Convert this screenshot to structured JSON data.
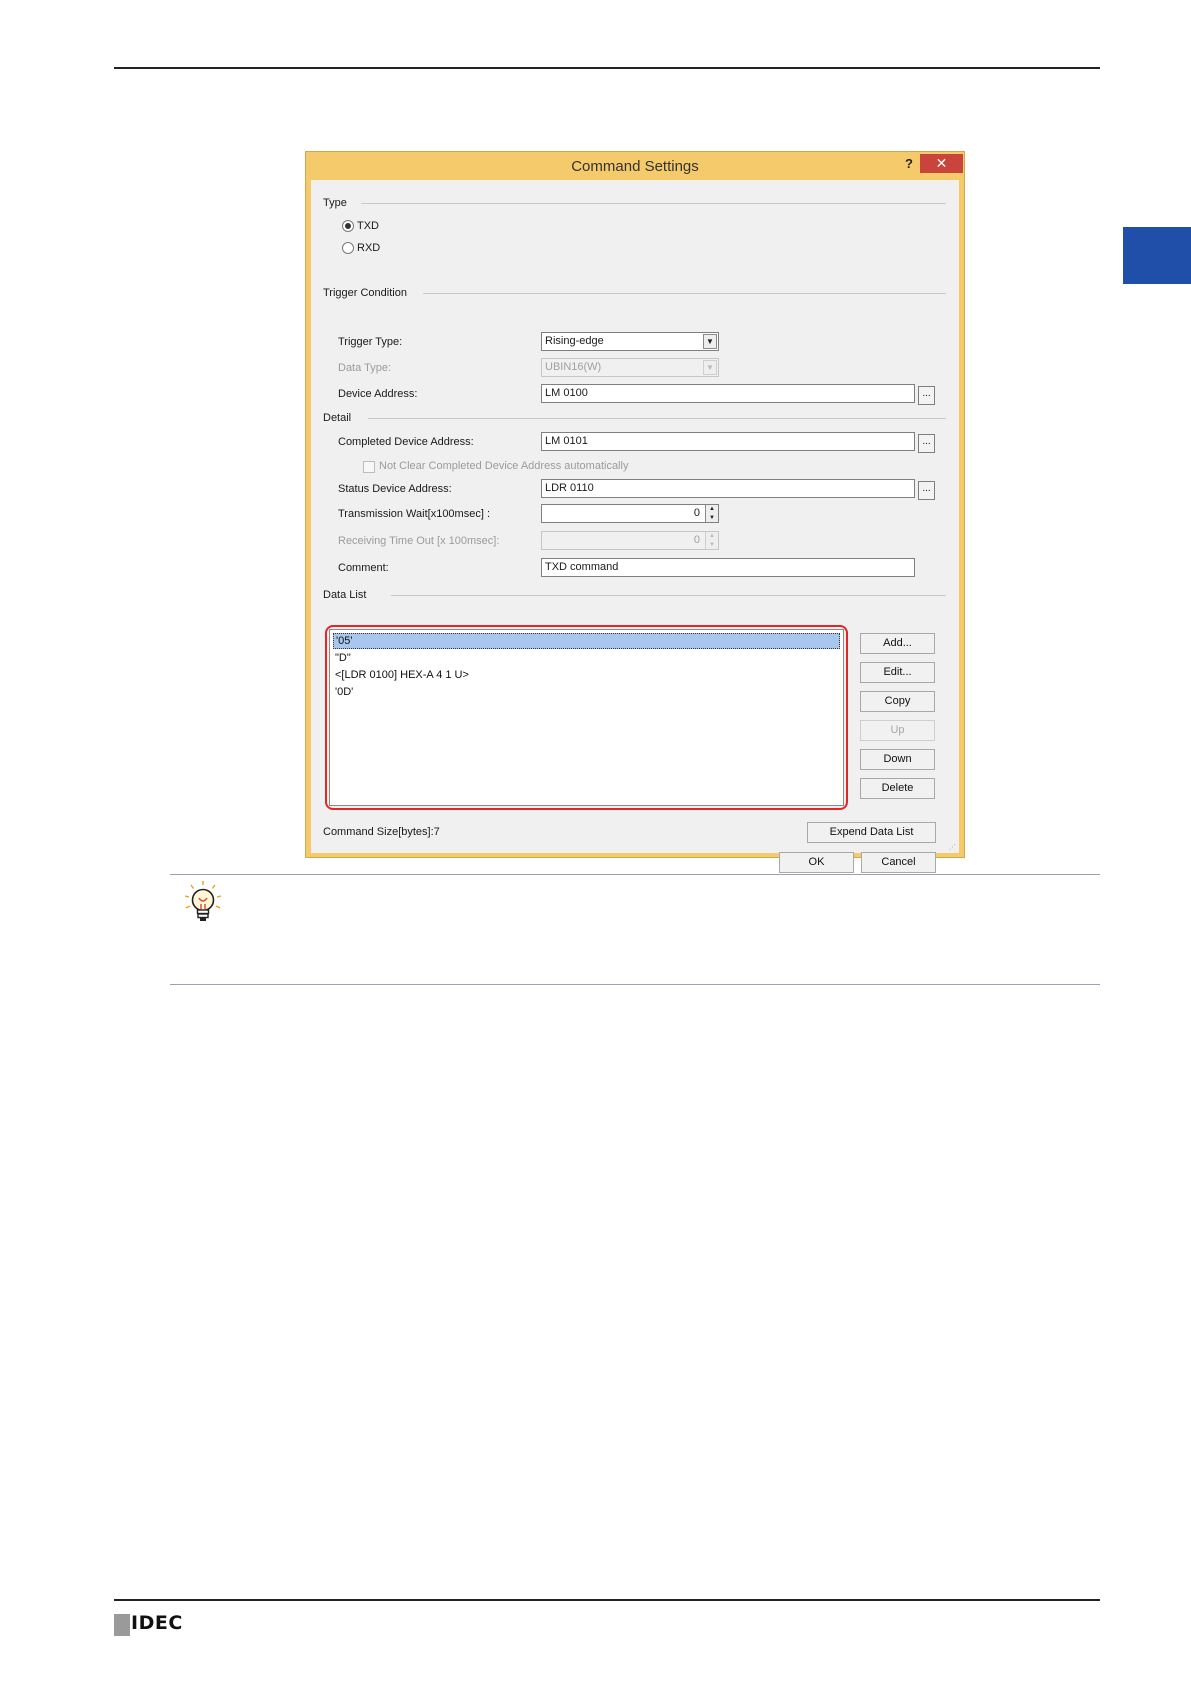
{
  "dialog": {
    "title": "Command Settings",
    "help_label": "?",
    "close_label": "✕",
    "type": {
      "group_label": "Type",
      "txd_label": "TXD",
      "rxd_label": "RXD"
    },
    "trigger": {
      "group_label": "Trigger Condition",
      "trigger_type_label": "Trigger Type:",
      "trigger_type_value": "Rising-edge",
      "data_type_label": "Data Type:",
      "data_type_value": "UBIN16(W)",
      "device_address_label": "Device Address:",
      "device_address_value": "LM 0100"
    },
    "detail": {
      "group_label": "Detail",
      "completed_label": "Completed Device Address:",
      "completed_value": "LM 0101",
      "not_clear_label": "Not Clear Completed Device Address automatically",
      "status_label": "Status Device Address:",
      "status_value": "LDR 0110",
      "transmission_wait_label": "Transmission Wait[x100msec] :",
      "transmission_wait_value": "0",
      "receiving_timeout_label": "Receiving Time Out [x 100msec]:",
      "receiving_timeout_value": "0",
      "comment_label": "Comment:",
      "comment_value": "TXD command"
    },
    "data_list": {
      "group_label": "Data List",
      "items": [
        "'05'",
        "\"D\"",
        "<[LDR 0100] HEX-A 4 1 U>",
        "'0D'"
      ],
      "buttons": {
        "add": "Add...",
        "edit": "Edit...",
        "copy": "Copy",
        "up": "Up",
        "down": "Down",
        "delete": "Delete",
        "expend": "Expend Data List"
      }
    },
    "command_size": "Command Size[bytes]:7",
    "ok_label": "OK",
    "cancel_label": "Cancel",
    "ellipsis": "..."
  },
  "footer": {
    "logo_text": "IDEC"
  },
  "colors": {
    "dialog_frame": "#f4ca6a",
    "close_button": "#c9443a",
    "highlight": "#e32626",
    "side_tab": "#1f4fa8",
    "selection": "#a9c7ec"
  }
}
